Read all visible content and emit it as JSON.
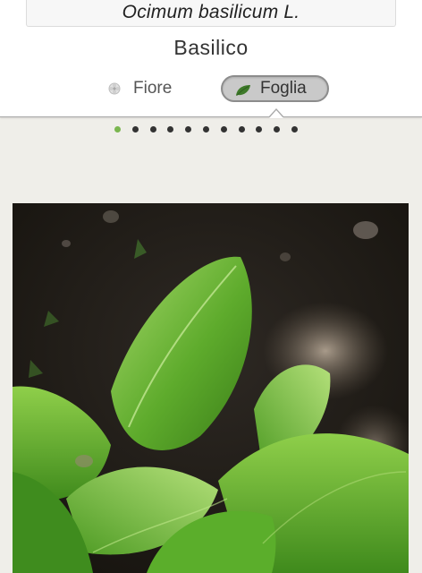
{
  "header": {
    "scientific_name": "Ocimum basilicum L.",
    "common_name": "Basilico"
  },
  "tabs": [
    {
      "label": "Fiore",
      "icon": "flower-icon",
      "selected": false
    },
    {
      "label": "Foglia",
      "icon": "leaf-icon",
      "selected": true
    }
  ],
  "pager": {
    "total": 11,
    "current": 1
  },
  "colors": {
    "accent_green": "#7ab64f",
    "leaf_icon": "#3e7a2a",
    "dot": "#333333"
  }
}
